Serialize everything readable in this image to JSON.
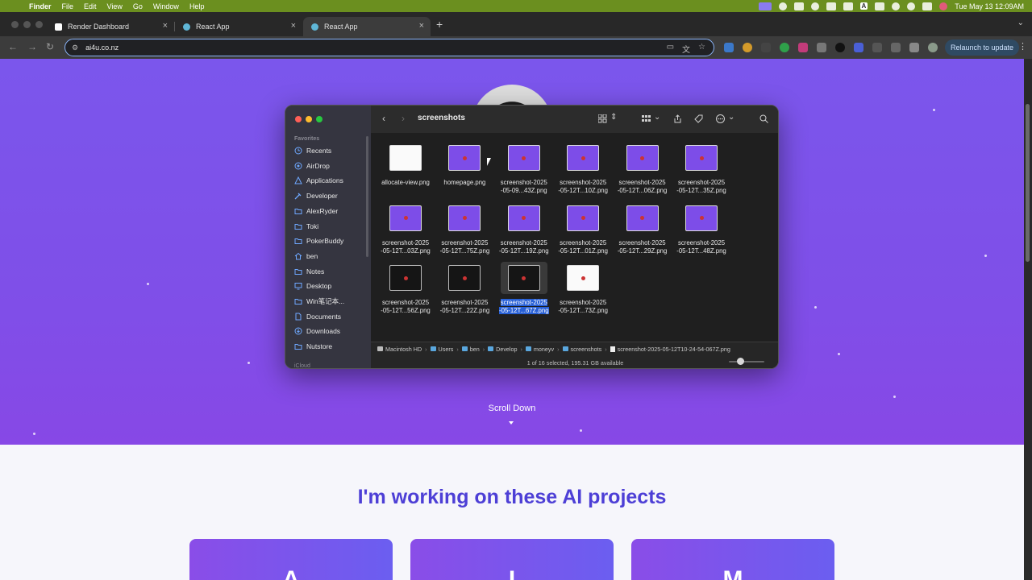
{
  "menubar": {
    "app_name": "Finder",
    "menus": [
      "File",
      "Edit",
      "View",
      "Go",
      "Window",
      "Help"
    ],
    "clock": "Tue May 13  12:09AM",
    "input_source": "A"
  },
  "browser": {
    "tabs": [
      {
        "title": "Render Dashboard"
      },
      {
        "title": "React App"
      },
      {
        "title": "React App"
      }
    ],
    "new_tab": "+",
    "url": "ai4u.co.nz",
    "relaunch_label": "Relaunch to update"
  },
  "page": {
    "scroll_label": "Scroll Down",
    "projects_heading": "I'm working on these AI projects",
    "project_cards": [
      {
        "letter": "A"
      },
      {
        "letter": "I"
      },
      {
        "letter": "M"
      }
    ]
  },
  "finder": {
    "title": "screenshots",
    "sidebar": {
      "favorites_label": "Favorites",
      "items": [
        {
          "label": "Recents",
          "icon": "clock-icon"
        },
        {
          "label": "AirDrop",
          "icon": "airdrop-icon"
        },
        {
          "label": "Applications",
          "icon": "applications-icon"
        },
        {
          "label": "Developer",
          "icon": "hammer-icon"
        },
        {
          "label": "AlexRyder",
          "icon": "folder-icon"
        },
        {
          "label": "Toki",
          "icon": "folder-icon"
        },
        {
          "label": "PokerBuddy",
          "icon": "folder-icon"
        },
        {
          "label": "ben",
          "icon": "home-icon"
        },
        {
          "label": "Notes",
          "icon": "folder-icon"
        },
        {
          "label": "Desktop",
          "icon": "desktop-icon"
        },
        {
          "label": "Win笔记本...",
          "icon": "folder-icon"
        },
        {
          "label": "Documents",
          "icon": "document-icon"
        },
        {
          "label": "Downloads",
          "icon": "download-icon"
        },
        {
          "label": "Nutstore",
          "icon": "folder-icon"
        }
      ],
      "icloud_label": "iCloud"
    },
    "files": [
      {
        "line1": "allocate-view.png",
        "line2": "",
        "thumb": "white"
      },
      {
        "line1": "homepage.png",
        "line2": "",
        "thumb": "purple"
      },
      {
        "line1": "screenshot-2025",
        "line2": "-05-09...43Z.png",
        "thumb": "purple"
      },
      {
        "line1": "screenshot-2025",
        "line2": "-05-12T...10Z.png",
        "thumb": "purple"
      },
      {
        "line1": "screenshot-2025",
        "line2": "-05-12T...06Z.png",
        "thumb": "purple"
      },
      {
        "line1": "screenshot-2025",
        "line2": "-05-12T...35Z.png",
        "thumb": "purple"
      },
      {
        "line1": "screenshot-2025",
        "line2": "-05-12T...03Z.png",
        "thumb": "purple"
      },
      {
        "line1": "screenshot-2025",
        "line2": "-05-12T...75Z.png",
        "thumb": "purple"
      },
      {
        "line1": "screenshot-2025",
        "line2": "-05-12T...19Z.png",
        "thumb": "purple"
      },
      {
        "line1": "screenshot-2025",
        "line2": "-05-12T...01Z.png",
        "thumb": "purple"
      },
      {
        "line1": "screenshot-2025",
        "line2": "-05-12T...29Z.png",
        "thumb": "purple"
      },
      {
        "line1": "screenshot-2025",
        "line2": "-05-12T...48Z.png",
        "thumb": "purple"
      },
      {
        "line1": "screenshot-2025",
        "line2": "-05-12T...56Z.png",
        "thumb": "dark"
      },
      {
        "line1": "screenshot-2025",
        "line2": "-05-12T...22Z.png",
        "thumb": "dark"
      },
      {
        "line1": "screenshot-2025",
        "line2": "-05-12T...67Z.png",
        "thumb": "dark",
        "selected": true
      },
      {
        "line1": "screenshot-2025",
        "line2": "-05-12T...73Z.png",
        "thumb": "white"
      }
    ],
    "path": [
      "Macintosh HD",
      "Users",
      "ben",
      "Develop",
      "moneyv",
      "screenshots",
      "screenshot-2025-05-12T10-24-54-067Z.png"
    ],
    "status": "1 of 16 selected, 195.31 GB available"
  },
  "colors": {
    "hero_purple": "#7b56ec",
    "heading_indigo": "#4d3fd6",
    "menubar_green": "#6b8f1f",
    "selection_blue": "#2860d6"
  }
}
